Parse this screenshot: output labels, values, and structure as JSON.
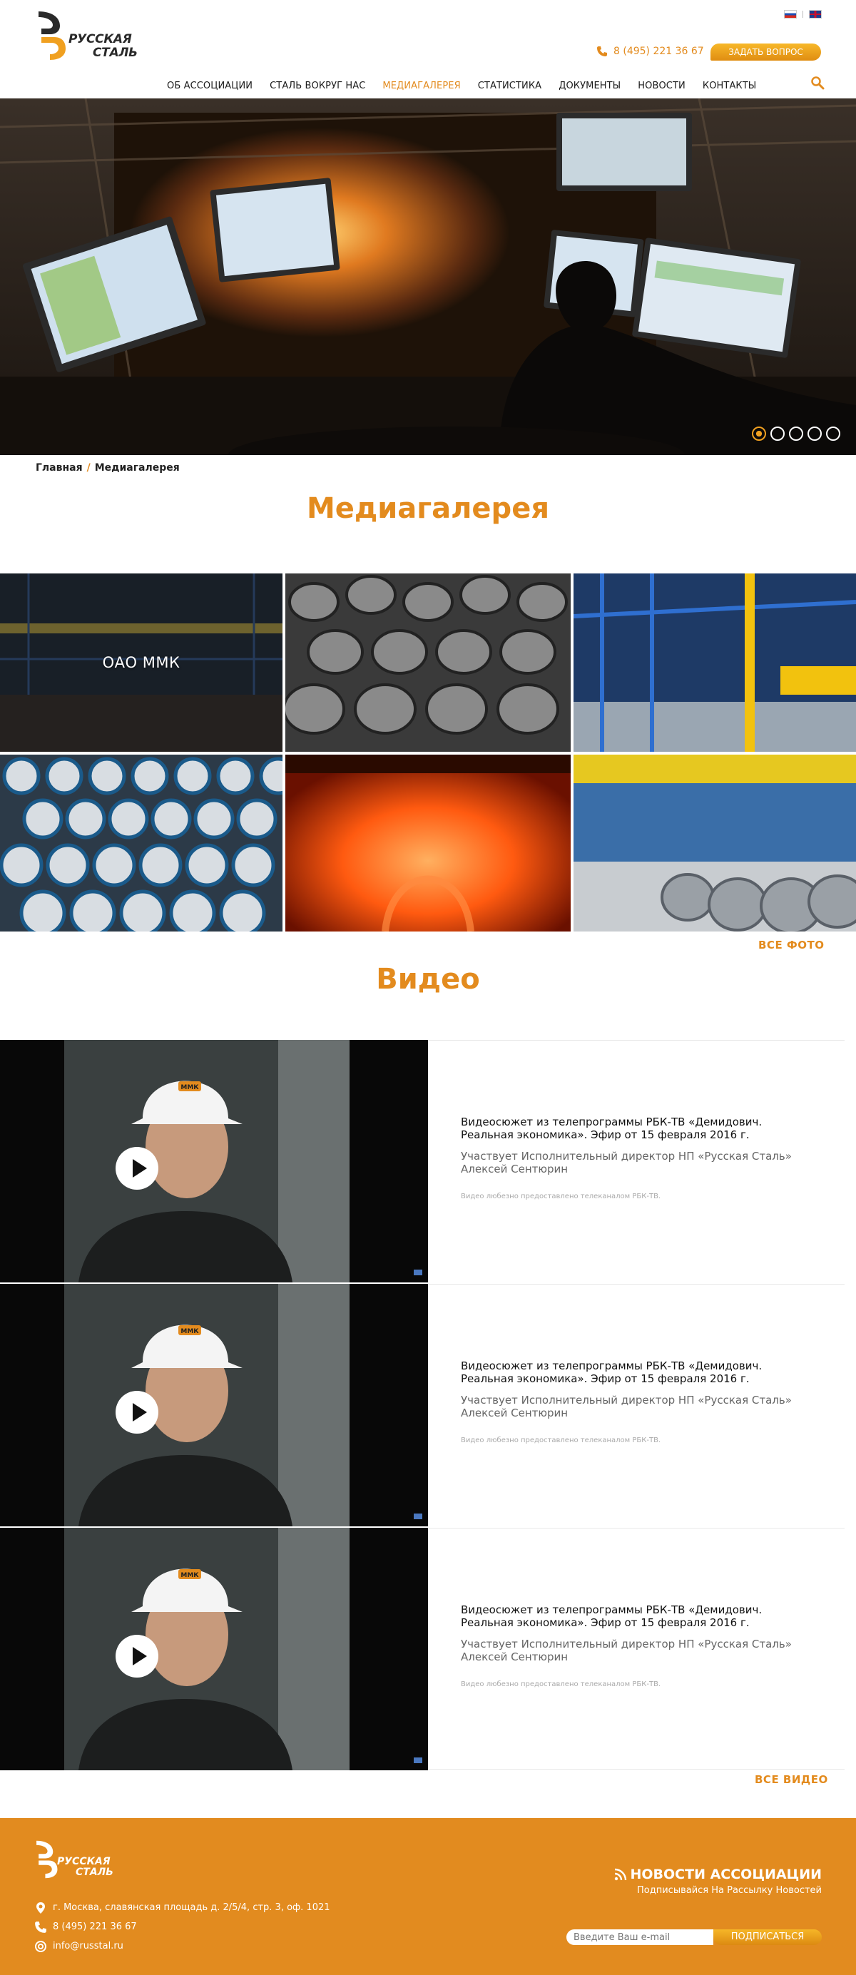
{
  "header": {
    "logo": {
      "line1": "РУССКАЯ",
      "line2": "СТАЛЬ"
    },
    "languages": [
      "ru",
      "en"
    ],
    "phone": "8 (495) 221 36 67",
    "ask_button": "ЗАДАТЬ ВОПРОС",
    "nav": [
      {
        "label": "ОБ АССОЦИАЦИИ",
        "active": false
      },
      {
        "label": "СТАЛЬ ВОКРУГ НАС",
        "active": false
      },
      {
        "label": "МЕДИАГАЛЕРЕЯ",
        "active": true
      },
      {
        "label": "СТАТИСТИКА",
        "active": false
      },
      {
        "label": "ДОКУМЕНТЫ",
        "active": false
      },
      {
        "label": "НОВОСТИ",
        "active": false
      },
      {
        "label": "КОНТАКТЫ",
        "active": false
      }
    ]
  },
  "hero": {
    "slide_count": 5,
    "active_slide": 1
  },
  "breadcrumb": {
    "home": "Главная",
    "separator": "/",
    "current": "Медиагалерея"
  },
  "page_title": "Медиагалерея",
  "gallery": {
    "albums": [
      {
        "label": "ОАО ММК"
      },
      {
        "label": ""
      },
      {
        "label": ""
      },
      {
        "label": ""
      },
      {
        "label": ""
      },
      {
        "label": ""
      }
    ],
    "all_photo": "ВСЕ ФОТО"
  },
  "video_section": {
    "title": "Видео",
    "items": [
      {
        "title": "Видеосюжет из телепрограммы РБК-ТВ «Демидович. Реальная экономика». Эфир от 15 февраля 2016 г.",
        "subtitle": "Участвует Исполнительный директор НП «Русская Сталь» Алексей Сентюрин",
        "credit": "Видео любезно предоставлено телеканалом РБК-ТВ.",
        "badge": "ММК"
      },
      {
        "title": "Видеосюжет из телепрограммы РБК-ТВ «Демидович. Реальная экономика». Эфир от 15 февраля 2016 г.",
        "subtitle": "Участвует Исполнительный директор НП «Русская Сталь» Алексей Сентюрин",
        "credit": "Видео любезно предоставлено телеканалом РБК-ТВ.",
        "badge": "ММК"
      },
      {
        "title": "Видеосюжет из телепрограммы РБК-ТВ «Демидович. Реальная экономика». Эфир от 15 февраля 2016 г.",
        "subtitle": "Участвует Исполнительный директор НП «Русская Сталь» Алексей Сентюрин",
        "credit": "Видео любезно предоставлено телеканалом РБК-ТВ.",
        "badge": "ММК"
      }
    ],
    "all_video": "ВСЕ ВИДЕО"
  },
  "footer": {
    "logo": {
      "line1": "РУССКАЯ",
      "line2": "СТАЛЬ"
    },
    "address": "г. Москва, славянская площадь д. 2/5/4, стр. 3, оф. 1021",
    "phone": "8 (495) 221 36 67",
    "email": "info@russtal.ru",
    "news_title": "НОВОСТИ АССОЦИАЦИИ",
    "news_subtitle": "Подписывайся На Рассылку Новостей",
    "email_placeholder": "Введите Ваш e-mail",
    "subscribe_button": "ПОДПИСАТЬСЯ"
  },
  "colors": {
    "accent": "#e38b1e",
    "footer_bg": "#e28b1f",
    "text": "#1b1b1b"
  }
}
